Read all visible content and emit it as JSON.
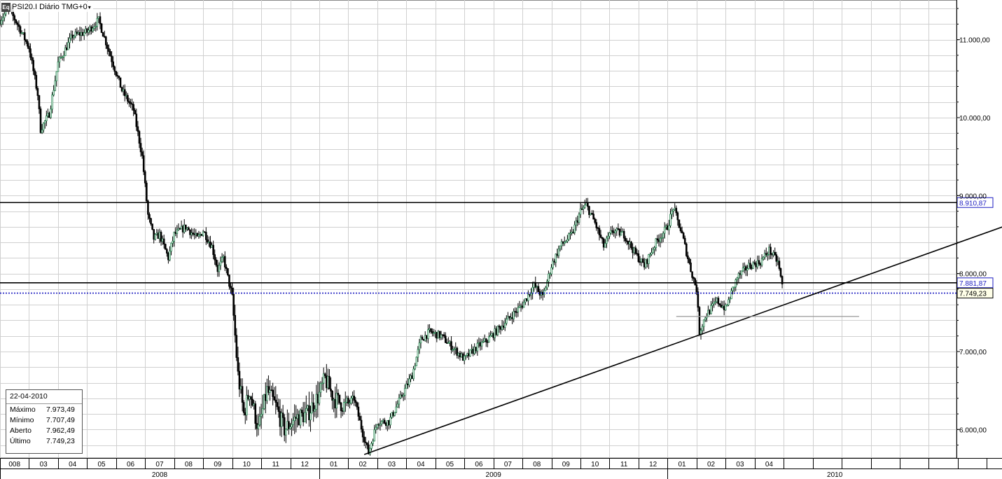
{
  "window": {
    "symbol_title": "PSI20.I Diário TMG+0",
    "eq_icon": "Eq",
    "dropdown_icon": "chevron-down-icon"
  },
  "info_box": {
    "date": "22-04-2010",
    "rows": [
      {
        "label": "Máximo",
        "value": "7.973,49"
      },
      {
        "label": "Mínimo",
        "value": "7.707,49"
      },
      {
        "label": "Aberto",
        "value": "7.962,49"
      },
      {
        "label": "Último",
        "value": "7.749,23"
      }
    ]
  },
  "colors": {
    "up_candle": "#2e8b57",
    "down_candle": "#000000",
    "grid": "#d0d0d0",
    "resistance_line": "#000000",
    "last_price_line": "#1c1cc0",
    "support_line": "#999999"
  },
  "chart_data": {
    "type": "candlestick",
    "title": "PSI20.I Diário TMG+0",
    "y_axis": {
      "min": 5600,
      "max": 11500,
      "ticks": [
        6000,
        7000,
        8000,
        9000,
        10000,
        11000
      ],
      "tick_labels": [
        "6.000,00",
        "7.000,00",
        "8.000,00",
        "9.000,00",
        "10.000,00",
        "11.000,00"
      ],
      "position": "right"
    },
    "x_axis": {
      "months": [
        "008",
        "03",
        "04",
        "05",
        "06",
        "07",
        "08",
        "09",
        "10",
        "11",
        "12",
        "01",
        "02",
        "03",
        "04",
        "05",
        "06",
        "07",
        "08",
        "09",
        "10",
        "11",
        "12",
        "01",
        "02",
        "03",
        "04",
        "",
        "",
        "",
        "",
        "",
        "",
        "",
        "",
        ""
      ],
      "years": [
        {
          "label": "2008",
          "start_month_index": 0,
          "end_month_index": 11
        },
        {
          "label": "2009",
          "start_month_index": 11,
          "end_month_index": 23
        },
        {
          "label": "2010",
          "start_month_index": 23,
          "end_month_index": 35
        }
      ],
      "grid": true
    },
    "price_labels": [
      {
        "value": 8910.87,
        "label": "8.910,87",
        "type": "resistance"
      },
      {
        "value": 7881.87,
        "label": "7.881,87",
        "type": "resistance"
      },
      {
        "value": 7749.23,
        "label": "7.749,23",
        "type": "last_price"
      }
    ],
    "trendline": {
      "start": {
        "month_index": 12.55,
        "value": 5680
      },
      "end": {
        "month_index": 35.0,
        "value": 8660
      }
    },
    "support_segment": {
      "start_month_index": 23.3,
      "end_month_index": 29.6,
      "value": 7450
    },
    "price_path": [
      {
        "m": 0.0,
        "v": 11250
      },
      {
        "m": 0.3,
        "v": 11400
      },
      {
        "m": 0.6,
        "v": 11200
      },
      {
        "m": 1.0,
        "v": 10900
      },
      {
        "m": 1.3,
        "v": 10300
      },
      {
        "m": 1.4,
        "v": 9850
      },
      {
        "m": 1.7,
        "v": 10050
      },
      {
        "m": 2.0,
        "v": 10700
      },
      {
        "m": 2.5,
        "v": 11050
      },
      {
        "m": 3.0,
        "v": 11100
      },
      {
        "m": 3.4,
        "v": 11250
      },
      {
        "m": 3.8,
        "v": 10800
      },
      {
        "m": 4.2,
        "v": 10350
      },
      {
        "m": 4.6,
        "v": 10100
      },
      {
        "m": 4.9,
        "v": 9500
      },
      {
        "m": 5.1,
        "v": 8750
      },
      {
        "m": 5.3,
        "v": 8450
      },
      {
        "m": 5.5,
        "v": 8500
      },
      {
        "m": 5.8,
        "v": 8200
      },
      {
        "m": 6.0,
        "v": 8500
      },
      {
        "m": 6.4,
        "v": 8600
      },
      {
        "m": 6.8,
        "v": 8450
      },
      {
        "m": 7.0,
        "v": 8550
      },
      {
        "m": 7.3,
        "v": 8350
      },
      {
        "m": 7.5,
        "v": 8050
      },
      {
        "m": 7.7,
        "v": 8200
      },
      {
        "m": 8.0,
        "v": 7700
      },
      {
        "m": 8.2,
        "v": 6700
      },
      {
        "m": 8.4,
        "v": 6200
      },
      {
        "m": 8.6,
        "v": 6500
      },
      {
        "m": 8.9,
        "v": 6000
      },
      {
        "m": 9.2,
        "v": 6500
      },
      {
        "m": 9.5,
        "v": 6300
      },
      {
        "m": 9.8,
        "v": 6000
      },
      {
        "m": 10.2,
        "v": 6150
      },
      {
        "m": 10.6,
        "v": 6200
      },
      {
        "m": 11.0,
        "v": 6450
      },
      {
        "m": 11.2,
        "v": 6650
      },
      {
        "m": 11.5,
        "v": 6400
      },
      {
        "m": 11.9,
        "v": 6300
      },
      {
        "m": 12.2,
        "v": 6400
      },
      {
        "m": 12.5,
        "v": 5950
      },
      {
        "m": 12.7,
        "v": 5700
      },
      {
        "m": 13.0,
        "v": 6100
      },
      {
        "m": 13.4,
        "v": 6100
      },
      {
        "m": 13.8,
        "v": 6400
      },
      {
        "m": 14.2,
        "v": 6700
      },
      {
        "m": 14.5,
        "v": 7150
      },
      {
        "m": 14.8,
        "v": 7250
      },
      {
        "m": 15.2,
        "v": 7200
      },
      {
        "m": 15.6,
        "v": 7050
      },
      {
        "m": 16.0,
        "v": 6900
      },
      {
        "m": 16.4,
        "v": 7050
      },
      {
        "m": 16.8,
        "v": 7150
      },
      {
        "m": 17.2,
        "v": 7300
      },
      {
        "m": 17.6,
        "v": 7450
      },
      {
        "m": 18.0,
        "v": 7600
      },
      {
        "m": 18.4,
        "v": 7850
      },
      {
        "m": 18.7,
        "v": 7700
      },
      {
        "m": 19.0,
        "v": 8100
      },
      {
        "m": 19.3,
        "v": 8350
      },
      {
        "m": 19.7,
        "v": 8500
      },
      {
        "m": 20.0,
        "v": 8800
      },
      {
        "m": 20.2,
        "v": 8880
      },
      {
        "m": 20.5,
        "v": 8650
      },
      {
        "m": 20.8,
        "v": 8350
      },
      {
        "m": 21.1,
        "v": 8550
      },
      {
        "m": 21.5,
        "v": 8500
      },
      {
        "m": 21.9,
        "v": 8250
      },
      {
        "m": 22.2,
        "v": 8100
      },
      {
        "m": 22.6,
        "v": 8400
      },
      {
        "m": 23.0,
        "v": 8600
      },
      {
        "m": 23.2,
        "v": 8850
      },
      {
        "m": 23.5,
        "v": 8500
      },
      {
        "m": 23.8,
        "v": 8050
      },
      {
        "m": 24.0,
        "v": 7800
      },
      {
        "m": 24.1,
        "v": 7250
      },
      {
        "m": 24.3,
        "v": 7450
      },
      {
        "m": 24.7,
        "v": 7650
      },
      {
        "m": 25.0,
        "v": 7550
      },
      {
        "m": 25.4,
        "v": 7950
      },
      {
        "m": 25.8,
        "v": 8100
      },
      {
        "m": 26.2,
        "v": 8150
      },
      {
        "m": 26.5,
        "v": 8300
      },
      {
        "m": 26.8,
        "v": 8150
      },
      {
        "m": 27.0,
        "v": 7749
      }
    ]
  }
}
